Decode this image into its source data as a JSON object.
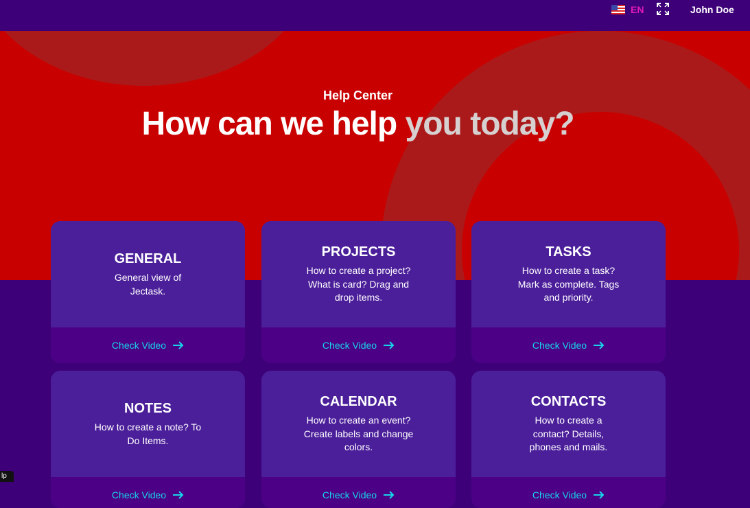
{
  "header": {
    "language": {
      "flag_icon": "us-flag-icon",
      "code": "EN",
      "code_color": "#e01ab8"
    },
    "fullscreen_icon": "expand-icon",
    "user_name": "John Doe"
  },
  "hero": {
    "subtitle": "Help Center",
    "title_part1": "How can we help ",
    "title_part2": "you today?",
    "background_color": "#c90000"
  },
  "cards": [
    {
      "title": "GENERAL",
      "description": "General view of Jectask.",
      "cta": "Check Video"
    },
    {
      "title": "PROJECTS",
      "description": "How to create a project? What is card? Drag and drop items.",
      "cta": "Check Video"
    },
    {
      "title": "TASKS",
      "description": "How to create a task? Mark as complete. Tags and priority.",
      "cta": "Check Video"
    },
    {
      "title": "NOTES",
      "description": "How to create a note? To Do Items.",
      "cta": "Check Video"
    },
    {
      "title": "CALENDAR",
      "description": "How to create an event? Create labels and change colors.",
      "cta": "Check Video"
    },
    {
      "title": "CONTACTS",
      "description": "How to create a contact? Details, phones and mails.",
      "cta": "Check Video"
    }
  ],
  "corner_tag": "lp",
  "colors": {
    "accent": "#18d4e8",
    "page_bg": "#3d0079",
    "card_bg": "#4b1f9a"
  }
}
